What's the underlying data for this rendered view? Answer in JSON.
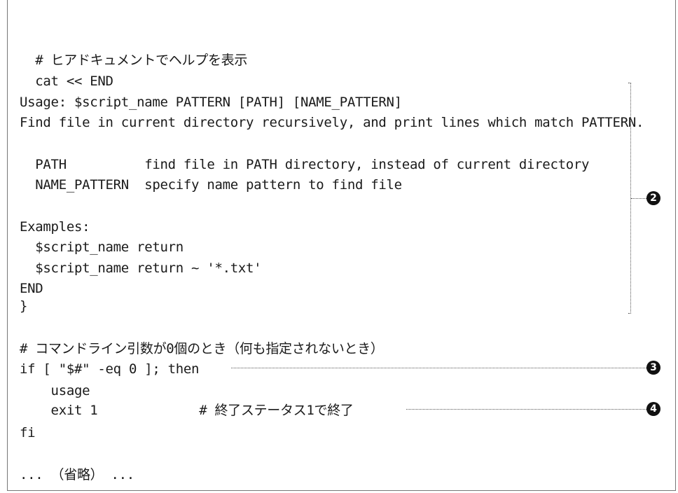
{
  "code_lines": [
    "  # ヒアドキュメントでヘルプを表示",
    "  cat << END",
    "Usage: $script_name PATTERN [PATH] [NAME_PATTERN]",
    "Find file in current directory recursively, and print lines which match PATTERN.",
    "",
    "  PATH          find file in PATH directory, instead of current directory",
    "  NAME_PATTERN  specify name pattern to find file",
    "",
    "Examples:",
    "  $script_name return",
    "  $script_name return ~ '*.txt'",
    "END",
    "}",
    "",
    "# コマンドライン引数が0個のとき（何も指定されないとき）",
    "if [ \"$#\" -eq 0 ]; then",
    "    usage",
    "    exit 1             # 終了ステータス1で終了",
    "fi",
    "",
    "... （省略） ..."
  ],
  "annotations": {
    "bracket_marker": "2",
    "if_marker": "3",
    "exit_marker": "4"
  }
}
